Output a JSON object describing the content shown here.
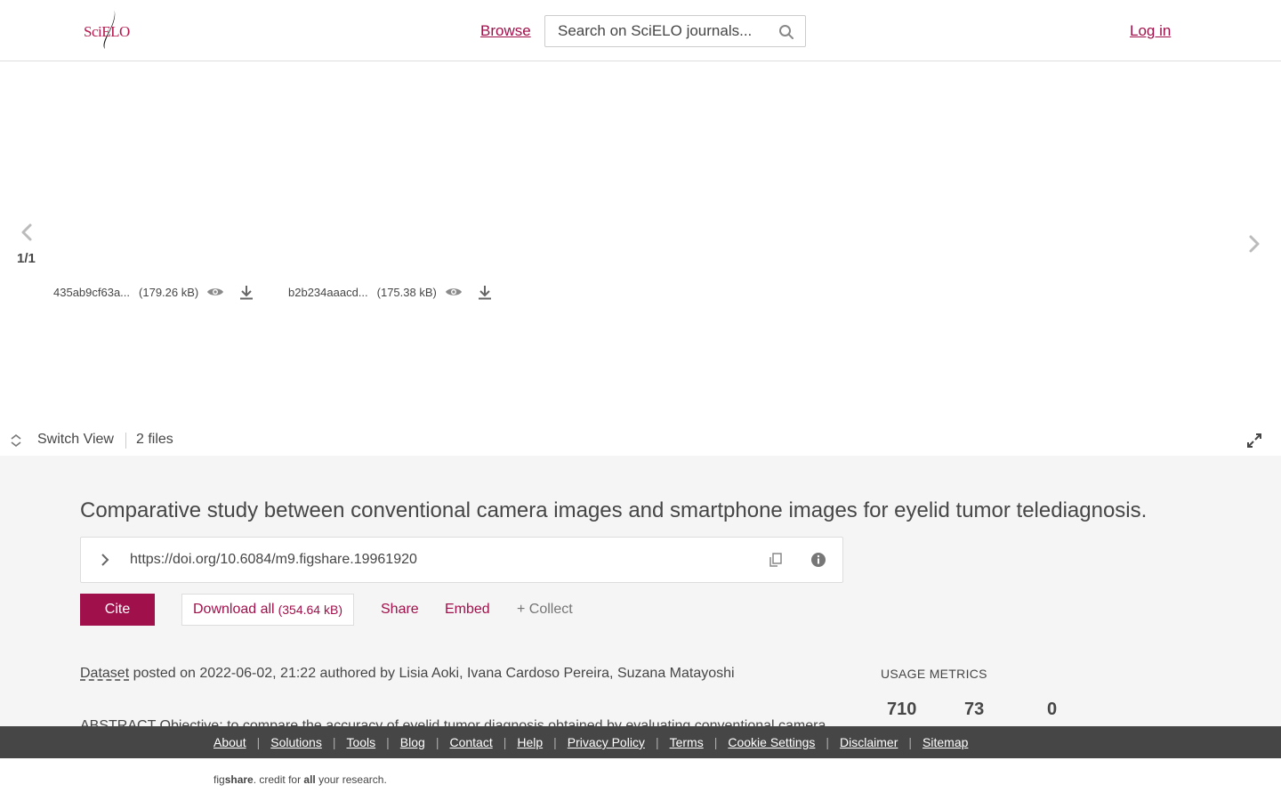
{
  "header": {
    "logo_text": "SciELO",
    "browse_label": "Browse",
    "search_placeholder": "Search on SciELO journals...",
    "login_label": "Log in"
  },
  "viewer": {
    "counter": "1/1",
    "files": [
      {
        "name": "435ab9cf63a...",
        "size": "(179.26 kB)"
      },
      {
        "name": "b2b234aaacd...",
        "size": "(175.38 kB)"
      }
    ],
    "switch_view_label": "Switch View",
    "files_count": "2 files"
  },
  "item": {
    "title": "Comparative study between conventional camera images and smartphone images for eyelid tumor telediagnosis.",
    "doi": "https://doi.org/10.6084/m9.figshare.19961920",
    "cite_label": "Cite",
    "download_label": "Download all",
    "download_size": "(354.64 kB)",
    "share_label": "Share",
    "embed_label": "Embed",
    "collect_label": "+ Collect",
    "type": "Dataset",
    "posted_text": " posted on 2022-06-02, 21:22 authored by Lisia Aoki, Ivana Cardoso Pereira, Suzana Matayoshi",
    "abstract": "ABSTRACT Objective: to compare the accuracy of eyelid tumor diagnosis obtained by evaluating conventional camera"
  },
  "metrics": {
    "label": "USAGE METRICS",
    "values": [
      "710",
      "73",
      "0"
    ]
  },
  "footer": {
    "links": [
      "About",
      "Solutions",
      "Tools",
      "Blog",
      "Contact",
      "Help",
      "Privacy Policy",
      "Terms",
      "Cookie Settings",
      "Disclaimer",
      "Sitemap"
    ],
    "credit_fig": "fig",
    "credit_share": "share",
    "credit_mid": ". credit for ",
    "credit_all": "all",
    "credit_end": " your research."
  },
  "colors": {
    "brand": "#a0104a",
    "footer_bg": "#464646",
    "main_bg": "#f5f5f5"
  }
}
